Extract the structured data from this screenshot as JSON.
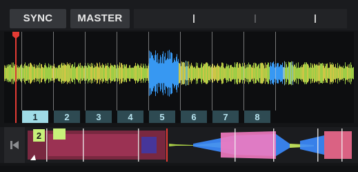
{
  "deck": {
    "sync_label": "SYNC",
    "master_label": "MASTER"
  },
  "beat_markers": {
    "labels": [
      "1",
      "2",
      "3",
      "4",
      "5",
      "6",
      "7",
      "8"
    ],
    "active_index": 0,
    "active_color": "#9fdbe6",
    "inactive_color": "#2e4a52"
  },
  "overview": {
    "cue_label": "2",
    "cue_color": "#c8f27a"
  },
  "colors": {
    "playhead": "#e53b34",
    "wave_green": "#a7d84a",
    "wave_yellow": "#d8d14a",
    "wave_blue": "#3aa0ff",
    "overview_red": "#8a2a46",
    "overview_pink": "#f27ac0",
    "overview_blue": "#3c8cff"
  }
}
